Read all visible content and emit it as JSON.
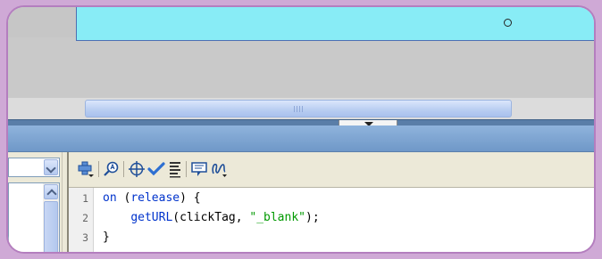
{
  "toolbar": {
    "icons": [
      "add-script-icon",
      "find-icon",
      "target-icon",
      "check-syntax-icon",
      "auto-format-icon",
      "code-hint-icon",
      "debug-icon"
    ]
  },
  "editor": {
    "lines": [
      {
        "num": "1",
        "parts": [
          {
            "text": "on",
            "type": "keyword"
          },
          {
            "text": " (",
            "type": "plain"
          },
          {
            "text": "release",
            "type": "keyword"
          },
          {
            "text": ") {",
            "type": "plain"
          }
        ]
      },
      {
        "num": "2",
        "parts": [
          {
            "text": "    ",
            "type": "plain"
          },
          {
            "text": "getURL",
            "type": "keyword"
          },
          {
            "text": "(clickTag, ",
            "type": "plain"
          },
          {
            "text": "\"_blank\"",
            "type": "string"
          },
          {
            "text": ");",
            "type": "plain"
          }
        ]
      },
      {
        "num": "3",
        "parts": [
          {
            "text": "}",
            "type": "plain"
          }
        ]
      }
    ]
  },
  "colors": {
    "stage": "#88ecf6",
    "frame_border": "#b47ebf",
    "panel_header": "#7aa1d0",
    "keyword": "#0033cc",
    "string": "#009900"
  }
}
